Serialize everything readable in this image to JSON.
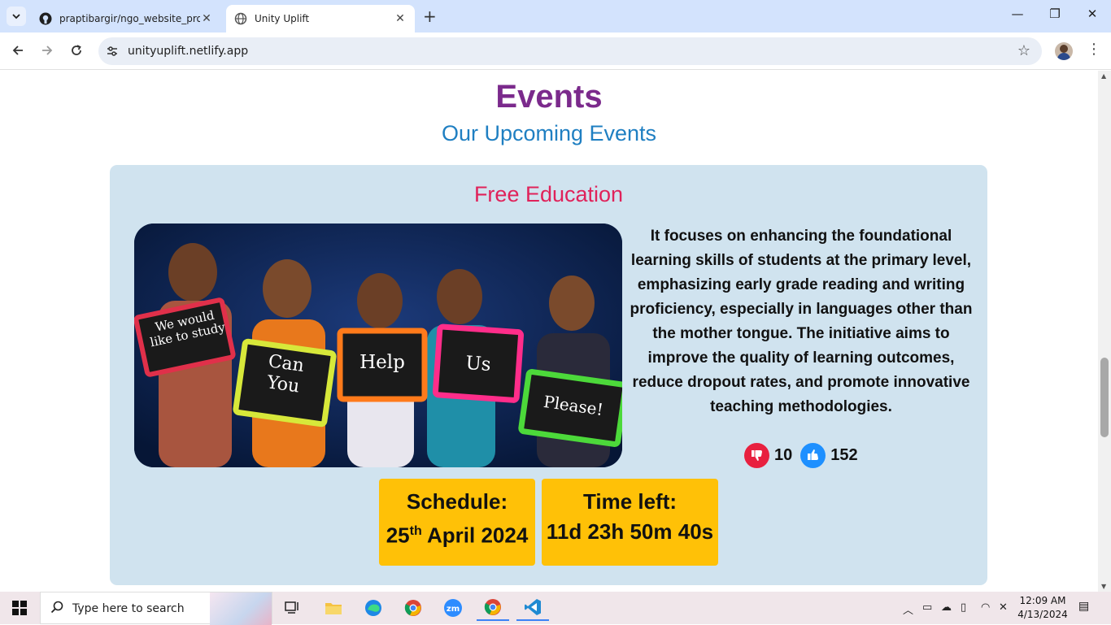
{
  "browser": {
    "tabs": [
      {
        "title": "praptibargir/ngo_website_proje",
        "icon": "github-icon",
        "active": false
      },
      {
        "title": "Unity Uplift",
        "icon": "globe-icon",
        "active": true
      }
    ],
    "url": "unityuplift.netlify.app"
  },
  "page": {
    "heading": "Events",
    "subheading": "Our Upcoming Events",
    "event": {
      "title": "Free Education",
      "image_signs": [
        "We would like to study",
        "Can You",
        "Help",
        "Us",
        "Please!"
      ],
      "description": "It focuses on enhancing the foundational learning skills of students at the primary level, emphasizing early grade reading and writing proficiency, especially in languages other than the mother tongue. The initiative aims to improve the quality of learning outcomes, reduce dropout rates, and promote innovative teaching methodologies.",
      "dislikes": "10",
      "likes": "152",
      "schedule_label": "Schedule:",
      "schedule_day": "25",
      "schedule_suffix": "th",
      "schedule_rest": " April 2024",
      "time_left_label": "Time left:",
      "time_left_value": "11d 23h 50m 40s"
    },
    "colors": {
      "heading": "#7b2a8c",
      "subheading": "#1f7fc2",
      "event_title": "#e0225a",
      "card_bg": "#d0e3ef",
      "info_box": "#ffc107"
    }
  },
  "taskbar": {
    "search_placeholder": "Type here to search",
    "time": "12:09 AM",
    "date": "4/13/2024"
  }
}
